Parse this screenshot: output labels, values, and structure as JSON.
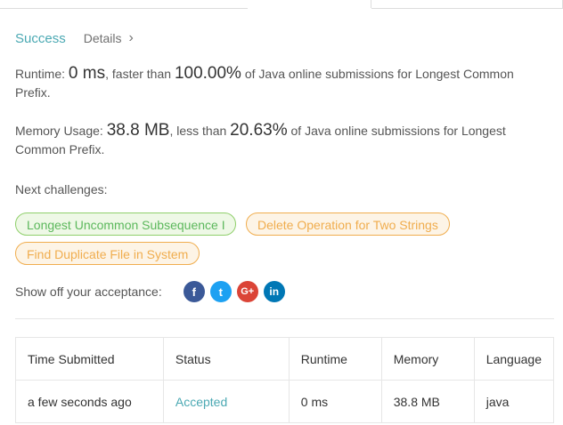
{
  "header": {
    "status": "Success",
    "details_label": "Details",
    "details_chevron": "›"
  },
  "runtime": {
    "prefix": "Runtime: ",
    "value": "0 ms",
    "mid": ", faster than ",
    "percent": "100.00%",
    "suffix": " of Java online submissions for Longest Common Prefix."
  },
  "memory": {
    "prefix": "Memory Usage: ",
    "value": "38.8 MB",
    "mid": ", less than ",
    "percent": "20.63%",
    "suffix": " of Java online submissions for Longest Common Prefix."
  },
  "next": {
    "label": "Next challenges:",
    "items": [
      {
        "title": "Longest Uncommon Subsequence I",
        "color": "#5cb85c"
      },
      {
        "title": "Delete Operation for Two Strings",
        "color": "#f0ad4e"
      },
      {
        "title": "Find Duplicate File in System",
        "color": "#f0ad4e"
      }
    ]
  },
  "share": {
    "label": "Show off your acceptance:",
    "icons": [
      "facebook-icon",
      "twitter-icon",
      "google-plus-icon",
      "linkedin-icon"
    ],
    "glyphs": [
      "f",
      "t",
      "G+",
      "in"
    ]
  },
  "table": {
    "headers": [
      "Time Submitted",
      "Status",
      "Runtime",
      "Memory",
      "Language"
    ],
    "rows": [
      {
        "time": "a few seconds ago",
        "status": "Accepted",
        "runtime": "0 ms",
        "memory": "38.8 MB",
        "language": "java"
      }
    ]
  }
}
